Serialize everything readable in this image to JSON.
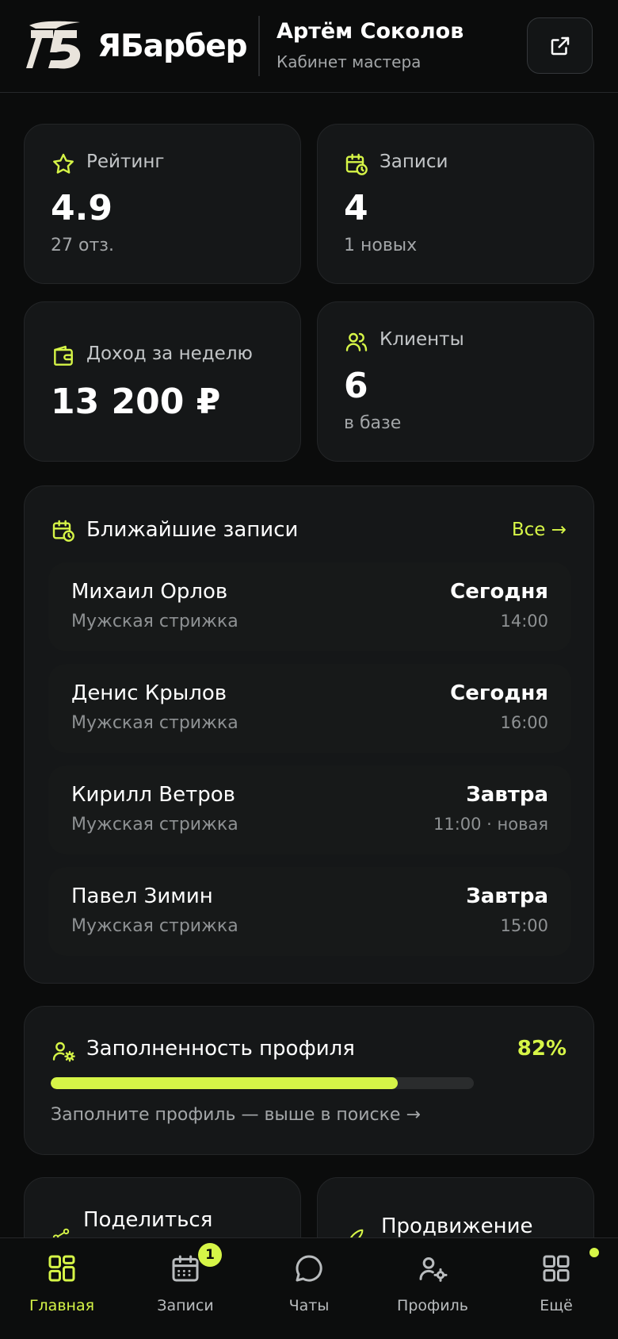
{
  "header": {
    "brand": "ЯБарбер",
    "user_name": "Артём Соколов",
    "user_role": "Кабинет мастера"
  },
  "stats": {
    "rating": {
      "label": "Рейтинг",
      "value": "4.9",
      "sub": "27 отз."
    },
    "bookings": {
      "label": "Записи",
      "value": "4",
      "sub": "1 новых"
    },
    "income": {
      "label": "Доход за неделю",
      "value": "13 200 ₽"
    },
    "clients": {
      "label": "Клиенты",
      "value": "6",
      "sub": "в базе"
    }
  },
  "upcoming": {
    "title": "Ближайшие записи",
    "all_link": "Все →",
    "items": [
      {
        "name": "Михаил Орлов",
        "service": "Мужская стрижка",
        "day": "Сегодня",
        "time": "14:00"
      },
      {
        "name": "Денис Крылов",
        "service": "Мужская стрижка",
        "day": "Сегодня",
        "time": "16:00"
      },
      {
        "name": "Кирилл Ветров",
        "service": "Мужская стрижка",
        "day": "Завтра",
        "time": "11:00 · новая"
      },
      {
        "name": "Павел Зимин",
        "service": "Мужская стрижка",
        "day": "Завтра",
        "time": "15:00"
      }
    ]
  },
  "profile_completion": {
    "title": "Заполненность профиля",
    "percent_label": "82%",
    "percent": 82,
    "hint": "Заполните профиль — выше в поиске →"
  },
  "actions": {
    "share": "Поделиться",
    "promo": "Продвижение"
  },
  "tabbar": {
    "home": "Главная",
    "bookings": "Записи",
    "bookings_badge": "1",
    "chats": "Чаты",
    "profile": "Профиль",
    "more": "Ещё"
  },
  "colors": {
    "accent": "#d6f547",
    "background": "#0b0c0c",
    "card": "#151718"
  }
}
